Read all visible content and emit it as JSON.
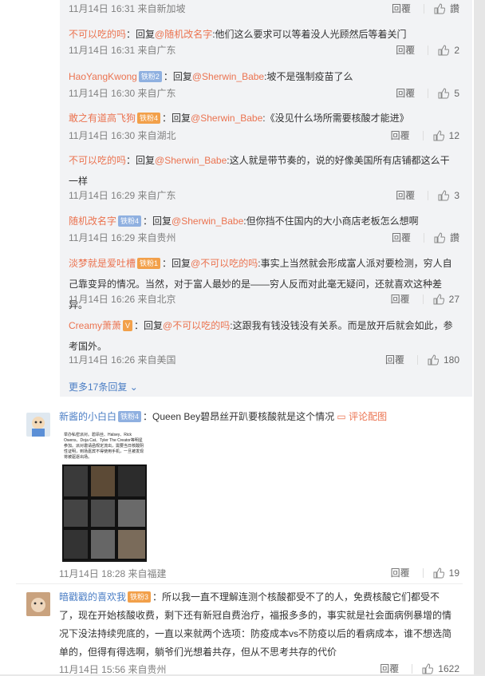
{
  "replies": [
    {
      "text": "",
      "time": "11月14日 16:31 来自新加坡",
      "likes": "讚"
    },
    {
      "user": "不可以吃的吗",
      "prefix": "：回复",
      "at": "@随机改名字",
      "text": ":他们这么要求可以等着没人光顾然后等着关门",
      "time": "11月14日 16:31 来自广东",
      "likes": "2"
    },
    {
      "user": "HaoYangKwong",
      "badge": "铁粉2",
      "prefix": "：回复",
      "at": "@Sherwin_Babe",
      "text": ":坡不是强制疫苗了么",
      "time": "11月14日 16:30 来自广东",
      "likes": "5"
    },
    {
      "user": "敢之有道高飞狗",
      "badge": "铁粉4",
      "prefix": "：回复",
      "at": "@Sherwin_Babe",
      "text": ":《没见什么场所需要核酸才能进》",
      "time": "11月14日 16:30 来自湖北",
      "likes": "12"
    },
    {
      "user": "不可以吃的吗",
      "prefix": "：回复",
      "at": "@Sherwin_Babe",
      "text": ":这人就是带节奏的，说的好像美国所有店铺都这么干一样",
      "time": "11月14日 16:29 来自广东",
      "likes": "3"
    },
    {
      "user": "随机改名字",
      "badge": "铁粉4",
      "prefix": "：回复",
      "at": "@Sherwin_Babe",
      "text": ":但你挡不住国内的大小商店老板怎么想啊",
      "time": "11月14日 16:29 来自贵州",
      "likes": "讚"
    },
    {
      "user": "淡梦就是爱吐槽",
      "badge": "铁粉1",
      "prefix": "：回复",
      "at": "@不可以吃的吗",
      "text": ":事实上当然就会形成富人派对要检测，穷人自己靠变异的情况。当然，对于富人最妙的是——穷人反而对此毫无疑问，还就喜欢这种差异。",
      "time": "11月14日 16:26 来自北京",
      "likes": "27"
    },
    {
      "user": "Creamy萧萧",
      "badge": "V",
      "prefix": "：回复",
      "at": "@不可以吃的吗",
      "text": ":这跟我有钱没钱没有关系。而是放开后就会如此，参考国外。",
      "time": "11月14日 16:26 来自美国",
      "likes": "180"
    }
  ],
  "more_replies": "更多17条回复",
  "reply_label": "回覆",
  "comment1": {
    "user": "新酱的小白白",
    "badge": "铁粉4",
    "text": "：Queen Bey碧昂丝开趴要核酸就是这个情况",
    "link": "评论配图",
    "time": "11月14日 18:28 来自福建",
    "likes": "19",
    "image_text": "举办私密派对。碧昂丝、Halsey、Rick Owens、Doja Cat、Tyler The Creator等明星参加。派对邀请函规定流出，需要当日核酸阴性证明，到场嘉宾不得使用手机，一旦被发现将被驱逐出场。"
  },
  "comment2": {
    "user": "暗戳戳的喜欢我",
    "badge": "铁粉3",
    "text": "：所以我一直不理解连测个核酸都受不了的人，免费核酸它们都受不了，现在开始核酸收费，剩下还有新冠自费治疗，福报多多的，事实就是社会面病例暴增的情况下没法持续兜底的，一直以来就两个选项：防疫成本vs不防疫以后的看病成本，谁不想选简单的，但得有得选啊，躺爷们光想着共存，但从不思考共存的代价",
    "time": "11月14日 15:56 来自贵州",
    "likes": "1622"
  }
}
